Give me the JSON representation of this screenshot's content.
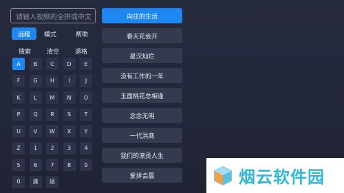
{
  "search": {
    "placeholder": "请输入视频的全拼或中文"
  },
  "modes": [
    {
      "label": "远程",
      "active": true
    },
    {
      "label": "模式",
      "active": false
    },
    {
      "label": "帮助",
      "active": false
    }
  ],
  "actions": [
    {
      "label": "搜索"
    },
    {
      "label": "清空"
    },
    {
      "label": "退格"
    }
  ],
  "keyboard": {
    "rows": [
      [
        "A",
        "B",
        "C",
        "D",
        "E"
      ],
      [
        "F",
        "G",
        "H",
        "I",
        "J"
      ],
      [
        "K",
        "L",
        "M",
        "N",
        "O"
      ],
      [
        "P",
        "Q",
        "R",
        "S",
        "T"
      ],
      [
        "U",
        "V",
        "W",
        "X",
        "Y"
      ],
      [
        "Z",
        "1",
        "2",
        "3",
        "4"
      ],
      [
        "5",
        "6",
        "7",
        "8",
        "9"
      ],
      [
        "0",
        "清",
        "退"
      ]
    ],
    "active_key": "A"
  },
  "results": [
    {
      "label": "向往的生活",
      "active": true
    },
    {
      "label": "春天花会开",
      "active": false
    },
    {
      "label": "星汉灿烂",
      "active": false
    },
    {
      "label": "没有工作的一年",
      "active": false
    },
    {
      "label": "玉面桃花总相逢",
      "active": false
    },
    {
      "label": "念念无明",
      "active": false
    },
    {
      "label": "一代洪商",
      "active": false
    },
    {
      "label": "我们的滚烫人生",
      "active": false
    },
    {
      "label": "爱拼会赢",
      "active": false
    }
  ],
  "watermark": {
    "text": "烟云软件园",
    "color": "#2fb8d6"
  },
  "colors": {
    "accent": "#1e88f0",
    "background": "#262a3d",
    "tile": "#353a4e"
  }
}
